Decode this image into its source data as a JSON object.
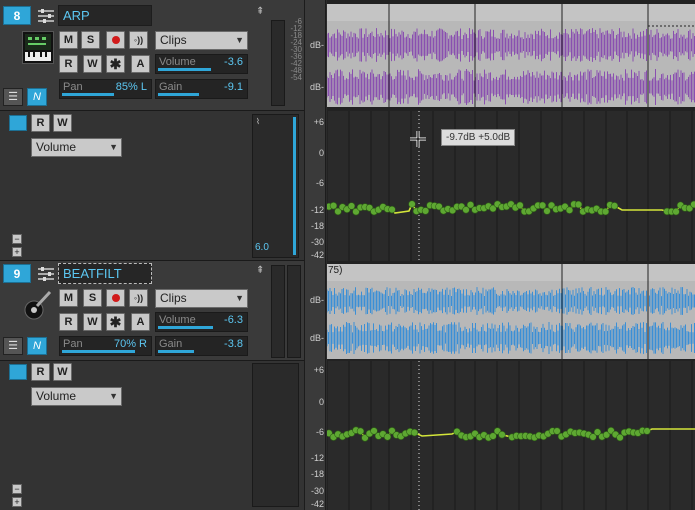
{
  "colors": {
    "accent": "#2fa6d8",
    "envelope": "#d4e63a",
    "node": "#5ea832",
    "audio_purple": "#8a4fb0",
    "audio_blue": "#3b8fd6"
  },
  "tracks": [
    {
      "number": "8",
      "name": "ARP",
      "buttons": {
        "mute": "M",
        "solo": "S",
        "read": "R",
        "write": "W",
        "freeze": "A"
      },
      "clips_dropdown": "Clips",
      "volume_label": "Volume",
      "volume_value": "-3.6",
      "volume_fill": 0.58,
      "pan_label": "Pan",
      "pan_value": "85% L",
      "pan_fill": 0.57,
      "gain_label": "Gain",
      "gain_value": "-9.1",
      "gain_fill": 0.45,
      "meter_scale": [
        "-6",
        "-12",
        "-18",
        "-24",
        "-30",
        "-36",
        "-42",
        "-48",
        "-54"
      ],
      "lane": {
        "read": "R",
        "write": "W",
        "param": "Volume",
        "readout": "6.0",
        "minus": "−",
        "plus": "+"
      }
    },
    {
      "number": "9",
      "name": "BEATFILT",
      "buttons": {
        "mute": "M",
        "solo": "S",
        "read": "R",
        "write": "W",
        "freeze": "A"
      },
      "clips_dropdown": "Clips",
      "volume_label": "Volume",
      "volume_value": "-6.3",
      "volume_fill": 0.6,
      "pan_label": "Pan",
      "pan_value": "70% R",
      "pan_fill": 0.8,
      "gain_label": "Gain",
      "gain_value": "-3.8",
      "gain_fill": 0.4,
      "lane": {
        "read": "R",
        "write": "W",
        "param": "Volume",
        "minus": "−",
        "plus": "+"
      }
    }
  ],
  "clip_db_label": "dB-",
  "envelope_scale": [
    "+6",
    "0",
    "-6",
    "-12",
    "-18",
    "-30",
    "-42"
  ],
  "envelope_scale2": [
    "+6",
    "0",
    "-6",
    "-12",
    "-18",
    "-30",
    "-42"
  ],
  "clip_fragment_label": "75)",
  "tooltip": "-9.7dB  +5.0dB"
}
